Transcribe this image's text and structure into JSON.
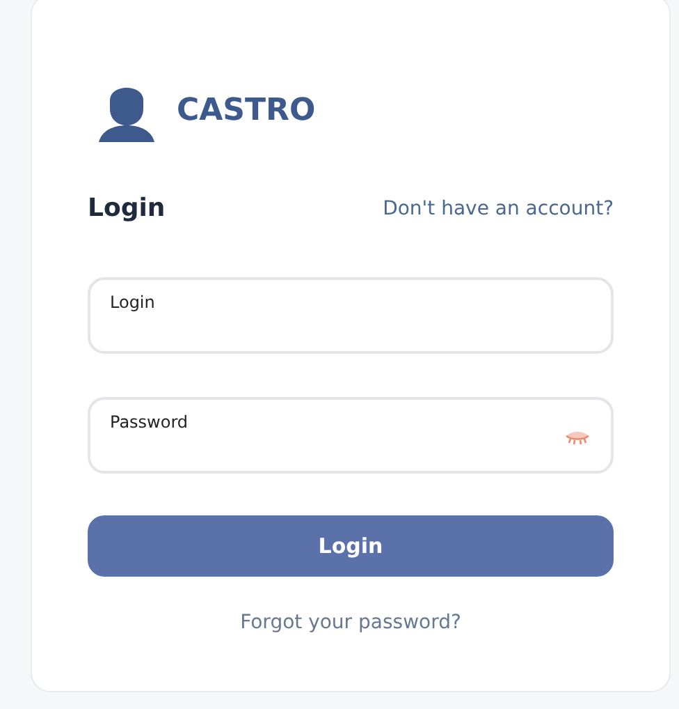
{
  "brand": {
    "name": "CASTRO"
  },
  "form": {
    "title": "Login",
    "signup_link": "Don't have an account?",
    "fields": [
      {
        "label": "Login",
        "kind": "text"
      },
      {
        "label": "Password",
        "kind": "password"
      }
    ],
    "submit": "Login",
    "forgot_link": "Forgot your password?"
  }
}
